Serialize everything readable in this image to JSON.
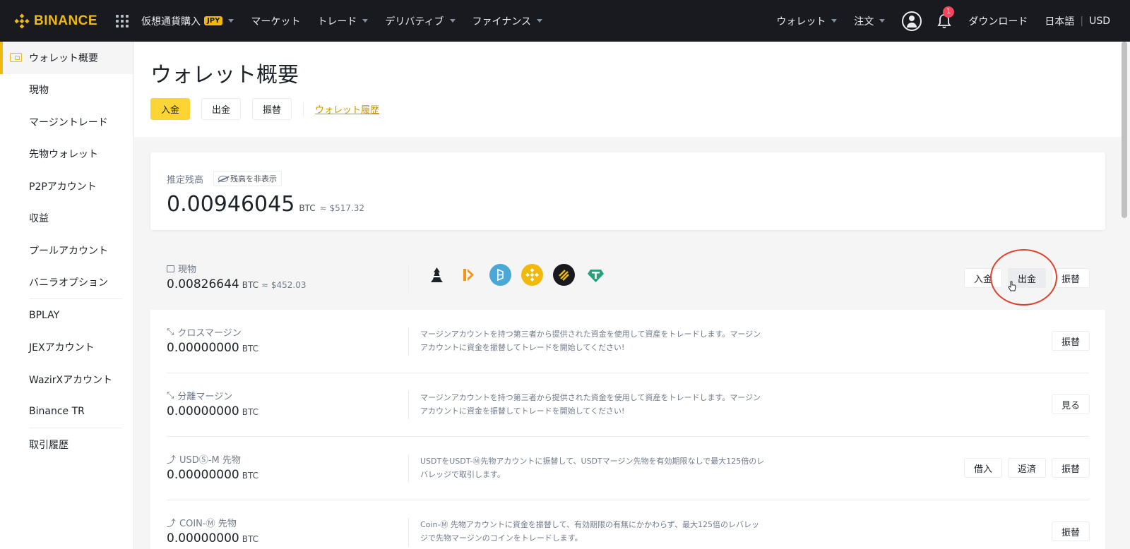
{
  "nav": {
    "logo": "BINANCE",
    "items": [
      {
        "label": "仮想通貨購入",
        "badge": "JPY",
        "caret": true
      },
      {
        "label": "マーケット",
        "caret": false
      },
      {
        "label": "トレード",
        "caret": true
      },
      {
        "label": "デリバティブ",
        "caret": true
      },
      {
        "label": "ファイナンス",
        "caret": true
      }
    ],
    "right": {
      "wallet": "ウォレット",
      "orders": "注文",
      "notif_count": "1",
      "download": "ダウンロード",
      "language": "日本語",
      "currency": "USD"
    }
  },
  "sidebar": {
    "items": [
      {
        "label": "ウォレット概要"
      },
      {
        "label": "現物"
      },
      {
        "label": "マージントレード"
      },
      {
        "label": "先物ウォレット"
      },
      {
        "label": "P2Pアカウント"
      },
      {
        "label": "収益"
      },
      {
        "label": "プールアカウント"
      },
      {
        "label": "バニラオプション"
      },
      {
        "label": "BPLAY"
      },
      {
        "label": "JEXアカウント"
      },
      {
        "label": "WazirXアカウント"
      },
      {
        "label": "Binance TR"
      },
      {
        "label": "取引履歴"
      }
    ]
  },
  "header": {
    "title": "ウォレット概要",
    "deposit": "入金",
    "withdraw": "出金",
    "transfer": "振替",
    "history": "ウォレット履歴"
  },
  "balance": {
    "label": "推定残高",
    "hide": "残高を非表示",
    "value": "0.00946045",
    "unit": "BTC",
    "approx": "≈ $517.32"
  },
  "accounts": [
    {
      "name": "現物",
      "value": "0.00826644",
      "unit": "BTC",
      "approx": "≈ $452.03",
      "buttons": [
        "入金",
        "出金",
        "振替"
      ]
    },
    {
      "name": "クロスマージン",
      "value": "0.00000000",
      "unit": "BTC",
      "desc": "マージンアカウントを持つ第三者から提供された資金を使用して資産をトレードします。マージンアカウントに資金を振替してトレードを開始してください!",
      "buttons": [
        "振替"
      ]
    },
    {
      "name": "分離マージン",
      "value": "0.00000000",
      "unit": "BTC",
      "desc": "マージンアカウントを持つ第三者から提供された資金を使用して資産をトレードします。マージンアカウントに資金を振替してトレードを開始してください!",
      "buttons": [
        "見る"
      ]
    },
    {
      "name": "USDⓈ-M 先物",
      "value": "0.00000000",
      "unit": "BTC",
      "desc": "USDTをUSDT-Ⓜ先物アカウントに振替して、USDTマージン先物を有効期限なしで最大125倍のレバレッジで取引します。",
      "buttons": [
        "借入",
        "返済",
        "振替"
      ]
    },
    {
      "name": "COIN-Ⓜ 先物",
      "value": "0.00000000",
      "unit": "BTC",
      "desc": "Coin-Ⓜ 先物アカウントに資金を振替して、有効期限の有無にかかわらず、最大125倍のレバレッジで先物マージンのコインをトレードします。",
      "buttons": [
        "振替"
      ]
    }
  ],
  "coins": [
    {
      "name": "pawn-coin-icon",
      "color": "#ffffff"
    },
    {
      "name": "orange-token-icon",
      "color": "#ffffff"
    },
    {
      "name": "fantom-icon",
      "color": "#4aa8d8"
    },
    {
      "name": "bnb-icon",
      "color": "#f0b90b"
    },
    {
      "name": "busd-icon",
      "color": "#181a20"
    },
    {
      "name": "tether-icon",
      "color": "#ffffff"
    }
  ]
}
